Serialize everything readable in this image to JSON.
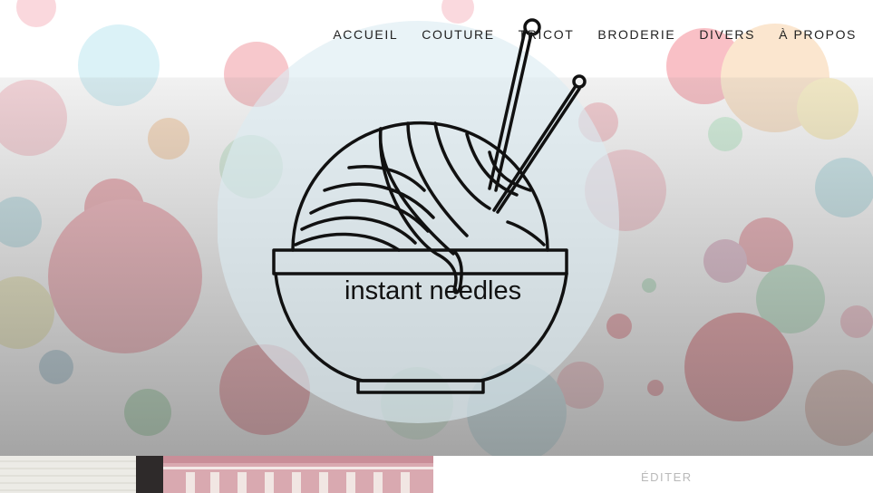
{
  "nav": {
    "items": [
      "ACCUEIL",
      "COUTURE",
      "TRICOT",
      "BRODERIE",
      "DIVERS",
      "À PROPOS"
    ]
  },
  "logo": {
    "text": "instant needles",
    "circle_color": "#dcecf2",
    "line_color": "#111111"
  },
  "hero": {
    "background": "bokeh",
    "colors": [
      "#f2a9b2",
      "#f6c9a3",
      "#bfe6ef",
      "#c9ecd5",
      "#fbe6a6",
      "#e6a2a8"
    ]
  },
  "post": {
    "edit_label": "ÉDITER"
  }
}
